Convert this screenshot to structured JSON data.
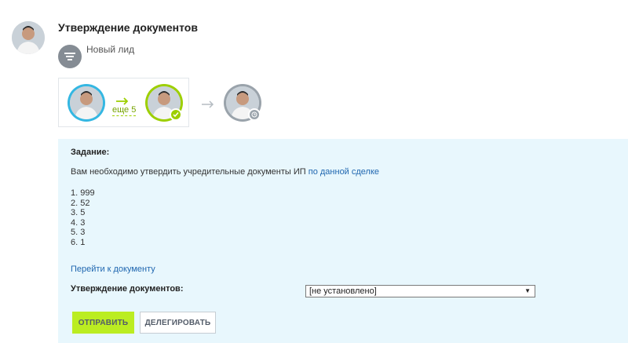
{
  "header": {
    "title": "Утверждение документов",
    "stage_label": "Новый лид"
  },
  "flow": {
    "more_label": "еще 5"
  },
  "task": {
    "heading": "Задание:",
    "text": "Вам необходимо утвердить учредительные документы ИП",
    "link": "по данной сделке",
    "items": [
      "1. 999",
      "2. 52",
      "3. 5",
      "4. 3",
      "5. 3",
      "6. 1"
    ],
    "goto_link": "Перейти к документу",
    "field_label": "Утверждение документов:",
    "field_value": "[не установлено]"
  },
  "buttons": {
    "send": "ОТПРАВИТЬ",
    "delegate": "ДЕЛЕГИРОВАТЬ"
  },
  "colors": {
    "panel_bg": "#e8f7fd",
    "accent_green": "#bbed21",
    "link_blue": "#2067b0",
    "ring_blue": "#34b7e2",
    "ring_green": "#9dcf00"
  }
}
